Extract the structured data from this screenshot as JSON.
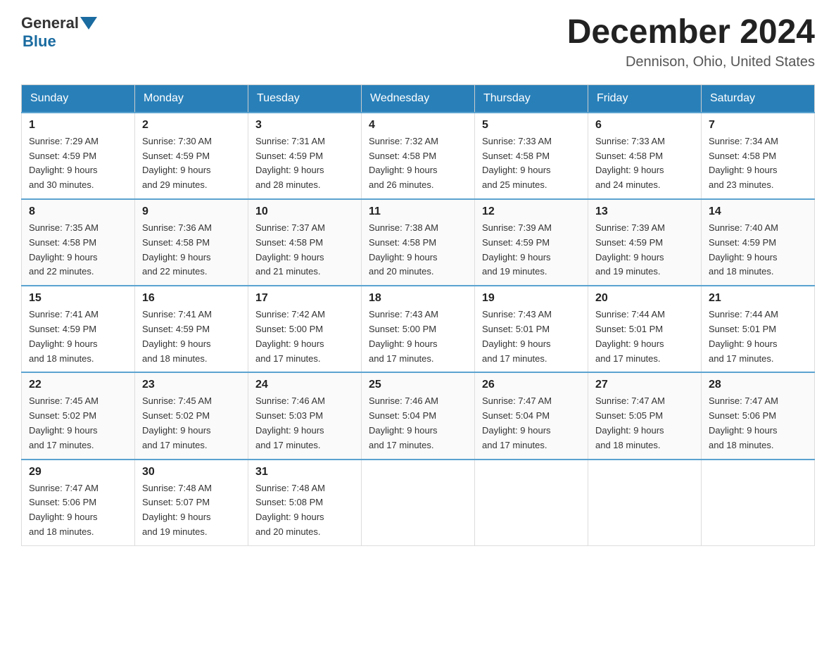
{
  "header": {
    "logo_general": "General",
    "logo_blue": "Blue",
    "month_title": "December 2024",
    "location": "Dennison, Ohio, United States"
  },
  "weekdays": [
    "Sunday",
    "Monday",
    "Tuesday",
    "Wednesday",
    "Thursday",
    "Friday",
    "Saturday"
  ],
  "weeks": [
    [
      {
        "day": "1",
        "sunrise": "7:29 AM",
        "sunset": "4:59 PM",
        "daylight": "9 hours and 30 minutes."
      },
      {
        "day": "2",
        "sunrise": "7:30 AM",
        "sunset": "4:59 PM",
        "daylight": "9 hours and 29 minutes."
      },
      {
        "day": "3",
        "sunrise": "7:31 AM",
        "sunset": "4:59 PM",
        "daylight": "9 hours and 28 minutes."
      },
      {
        "day": "4",
        "sunrise": "7:32 AM",
        "sunset": "4:58 PM",
        "daylight": "9 hours and 26 minutes."
      },
      {
        "day": "5",
        "sunrise": "7:33 AM",
        "sunset": "4:58 PM",
        "daylight": "9 hours and 25 minutes."
      },
      {
        "day": "6",
        "sunrise": "7:33 AM",
        "sunset": "4:58 PM",
        "daylight": "9 hours and 24 minutes."
      },
      {
        "day": "7",
        "sunrise": "7:34 AM",
        "sunset": "4:58 PM",
        "daylight": "9 hours and 23 minutes."
      }
    ],
    [
      {
        "day": "8",
        "sunrise": "7:35 AM",
        "sunset": "4:58 PM",
        "daylight": "9 hours and 22 minutes."
      },
      {
        "day": "9",
        "sunrise": "7:36 AM",
        "sunset": "4:58 PM",
        "daylight": "9 hours and 22 minutes."
      },
      {
        "day": "10",
        "sunrise": "7:37 AM",
        "sunset": "4:58 PM",
        "daylight": "9 hours and 21 minutes."
      },
      {
        "day": "11",
        "sunrise": "7:38 AM",
        "sunset": "4:58 PM",
        "daylight": "9 hours and 20 minutes."
      },
      {
        "day": "12",
        "sunrise": "7:39 AM",
        "sunset": "4:59 PM",
        "daylight": "9 hours and 19 minutes."
      },
      {
        "day": "13",
        "sunrise": "7:39 AM",
        "sunset": "4:59 PM",
        "daylight": "9 hours and 19 minutes."
      },
      {
        "day": "14",
        "sunrise": "7:40 AM",
        "sunset": "4:59 PM",
        "daylight": "9 hours and 18 minutes."
      }
    ],
    [
      {
        "day": "15",
        "sunrise": "7:41 AM",
        "sunset": "4:59 PM",
        "daylight": "9 hours and 18 minutes."
      },
      {
        "day": "16",
        "sunrise": "7:41 AM",
        "sunset": "4:59 PM",
        "daylight": "9 hours and 18 minutes."
      },
      {
        "day": "17",
        "sunrise": "7:42 AM",
        "sunset": "5:00 PM",
        "daylight": "9 hours and 17 minutes."
      },
      {
        "day": "18",
        "sunrise": "7:43 AM",
        "sunset": "5:00 PM",
        "daylight": "9 hours and 17 minutes."
      },
      {
        "day": "19",
        "sunrise": "7:43 AM",
        "sunset": "5:01 PM",
        "daylight": "9 hours and 17 minutes."
      },
      {
        "day": "20",
        "sunrise": "7:44 AM",
        "sunset": "5:01 PM",
        "daylight": "9 hours and 17 minutes."
      },
      {
        "day": "21",
        "sunrise": "7:44 AM",
        "sunset": "5:01 PM",
        "daylight": "9 hours and 17 minutes."
      }
    ],
    [
      {
        "day": "22",
        "sunrise": "7:45 AM",
        "sunset": "5:02 PM",
        "daylight": "9 hours and 17 minutes."
      },
      {
        "day": "23",
        "sunrise": "7:45 AM",
        "sunset": "5:02 PM",
        "daylight": "9 hours and 17 minutes."
      },
      {
        "day": "24",
        "sunrise": "7:46 AM",
        "sunset": "5:03 PM",
        "daylight": "9 hours and 17 minutes."
      },
      {
        "day": "25",
        "sunrise": "7:46 AM",
        "sunset": "5:04 PM",
        "daylight": "9 hours and 17 minutes."
      },
      {
        "day": "26",
        "sunrise": "7:47 AM",
        "sunset": "5:04 PM",
        "daylight": "9 hours and 17 minutes."
      },
      {
        "day": "27",
        "sunrise": "7:47 AM",
        "sunset": "5:05 PM",
        "daylight": "9 hours and 18 minutes."
      },
      {
        "day": "28",
        "sunrise": "7:47 AM",
        "sunset": "5:06 PM",
        "daylight": "9 hours and 18 minutes."
      }
    ],
    [
      {
        "day": "29",
        "sunrise": "7:47 AM",
        "sunset": "5:06 PM",
        "daylight": "9 hours and 18 minutes."
      },
      {
        "day": "30",
        "sunrise": "7:48 AM",
        "sunset": "5:07 PM",
        "daylight": "9 hours and 19 minutes."
      },
      {
        "day": "31",
        "sunrise": "7:48 AM",
        "sunset": "5:08 PM",
        "daylight": "9 hours and 20 minutes."
      },
      null,
      null,
      null,
      null
    ]
  ],
  "labels": {
    "sunrise": "Sunrise:",
    "sunset": "Sunset:",
    "daylight": "Daylight:"
  }
}
